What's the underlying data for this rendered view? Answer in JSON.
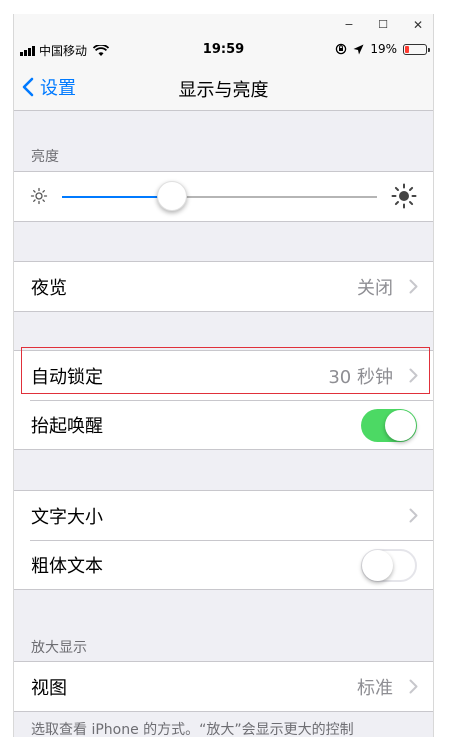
{
  "window": {
    "minimize_label": "−",
    "maximize_label": "☐",
    "close_label": "✕"
  },
  "status_bar": {
    "carrier": "中国移动",
    "time": "19:59",
    "battery_percent": "19%",
    "battery_level": 0.19,
    "battery_color": "#ff3b30"
  },
  "nav": {
    "back_label": "设置",
    "title": "显示与亮度"
  },
  "brightness": {
    "header": "亮度",
    "level": 0.35,
    "accent": "#007aff"
  },
  "night_shift": {
    "label": "夜览",
    "value": "关闭"
  },
  "auto_lock": {
    "label": "自动锁定",
    "value": "30 秒钟"
  },
  "raise_to_wake": {
    "label": "抬起唤醒",
    "enabled": true,
    "on_color": "#4cd964"
  },
  "text_size": {
    "label": "文字大小"
  },
  "bold_text": {
    "label": "粗体文本",
    "enabled": false
  },
  "zoom": {
    "header": "放大显示",
    "view_label": "视图",
    "view_value": "标准",
    "footer": "选取查看 iPhone 的方式。“放大”会显示更大的控制"
  }
}
